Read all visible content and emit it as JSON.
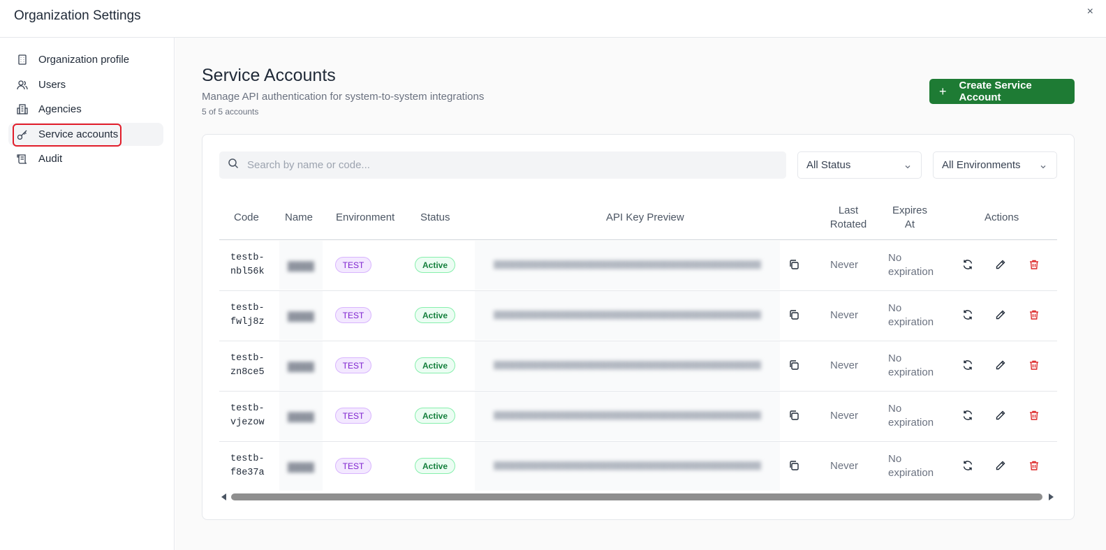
{
  "window": {
    "title": "Organization Settings",
    "close_label": "×"
  },
  "sidebar": {
    "items": [
      {
        "label": "Organization profile",
        "icon": "building-icon"
      },
      {
        "label": "Users",
        "icon": "users-icon"
      },
      {
        "label": "Agencies",
        "icon": "agencies-icon"
      },
      {
        "label": "Service accounts",
        "icon": "key-icon",
        "active": true
      },
      {
        "label": "Audit",
        "icon": "scroll-icon"
      }
    ]
  },
  "page": {
    "title": "Service Accounts",
    "subtitle": "Manage API authentication for system-to-system integrations",
    "count": "5 of 5 accounts",
    "create_button": "Create Service Account"
  },
  "filters": {
    "search_placeholder": "Search by name or code...",
    "status_value": "All Status",
    "environment_value": "All Environments"
  },
  "table": {
    "headers": {
      "code": "Code",
      "name": "Name",
      "environment": "Environment",
      "status": "Status",
      "api_key_preview": "API Key Preview",
      "last_rotated_1": "Last",
      "last_rotated_2": "Rotated",
      "expires_at_1": "Expires",
      "expires_at_2": "At",
      "actions": "Actions"
    },
    "rows": [
      {
        "code_1": "testb-",
        "code_2": "nbl56k",
        "environment": "TEST",
        "status": "Active",
        "last_rotated": "Never",
        "expires_1": "No",
        "expires_2": "expiration"
      },
      {
        "code_1": "testb-",
        "code_2": "fwlj8z",
        "environment": "TEST",
        "status": "Active",
        "last_rotated": "Never",
        "expires_1": "No",
        "expires_2": "expiration"
      },
      {
        "code_1": "testb-",
        "code_2": "zn8ce5",
        "environment": "TEST",
        "status": "Active",
        "last_rotated": "Never",
        "expires_1": "No",
        "expires_2": "expiration"
      },
      {
        "code_1": "testb-",
        "code_2": "vjezow",
        "environment": "TEST",
        "status": "Active",
        "last_rotated": "Never",
        "expires_1": "No",
        "expires_2": "expiration"
      },
      {
        "code_1": "testb-",
        "code_2": "f8e37a",
        "environment": "TEST",
        "status": "Active",
        "last_rotated": "Never",
        "expires_1": "No",
        "expires_2": "expiration"
      }
    ]
  },
  "colors": {
    "accent": "#1e7b34",
    "highlight": "#e11d2a",
    "delete": "#dc2626",
    "test_badge": "#7e22ce",
    "active_badge": "#15803d"
  }
}
